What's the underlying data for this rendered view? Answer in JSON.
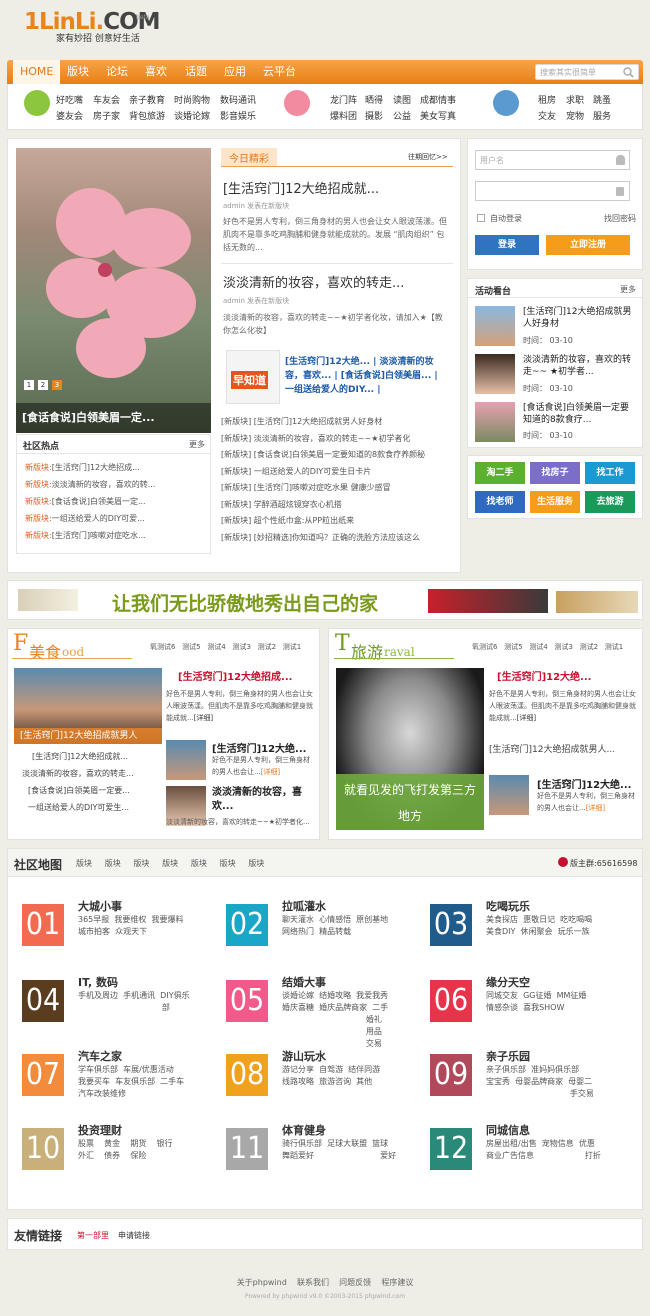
{
  "logo": {
    "text_a": "1LinLi.",
    "text_b": "COM",
    "slogan": "家有妙招 创意好生活",
    "beta": "beta"
  },
  "nav": {
    "items": [
      "HOME",
      "版块",
      "论坛",
      "喜欢",
      "话题",
      "应用",
      "云平台"
    ],
    "search_placeholder": "搜索其实很简单"
  },
  "quick": {
    "group1": [
      "好吃嘴",
      "车友会",
      "亲子教育",
      "时尚购物",
      "数码通讯",
      "婆友会",
      "房子家",
      "背包旅游",
      "谈婚论嫁",
      "影音娱乐"
    ],
    "group2": [
      "龙门阵",
      "晒得",
      "读图",
      "成都情事",
      "爆料团",
      "摄影",
      "公益",
      "美女写真"
    ],
    "group3": [
      "租房",
      "求职",
      "跳蚤",
      "交友",
      "宠物",
      "服务"
    ]
  },
  "hot": {
    "caption": "[食话食说]白领美眉一定...",
    "pages": [
      "1",
      "2",
      "3"
    ],
    "community_title": "社区热点",
    "more": "更多",
    "community": [
      {
        "tag": "新版块:",
        "text": "[生活窍门]12大绝招成..."
      },
      {
        "tag": "新版块:",
        "text": "淡淡清新的妆容，喜欢的转..."
      },
      {
        "tag": "新版块:",
        "text": "[食话食说]白领美眉一定..."
      },
      {
        "tag": "新版块:",
        "text": "一组送给爱人的DIY可爱..."
      },
      {
        "tag": "新版块:",
        "text": "[生活窍门]咳嗽对症吃水..."
      }
    ]
  },
  "today": {
    "label": "今日精彩",
    "past": "往期回忆>>",
    "a1": {
      "title": "[生活窍门]12大绝招成就...",
      "meta": "admin 发表在新版块",
      "desc": "好色不是男人专利，倒三角身材的男人也会让女人眼波荡漾。但肌肉不是靠多吃鸡胸脯和健身就能成就的。发展 “肌肉组织” 包括无数的..."
    },
    "a2": {
      "title": "淡淡清新的妆容，喜欢的转走...",
      "meta": "admin 发表在新版块",
      "desc": "淡淡清新的妆容，喜欢的转走~~★初学者化妆，请加入★【教你怎么化妆】"
    },
    "zhidao_logo": "早知道",
    "zhidao": "[生活窍门]12大绝... | 淡淡清新的妆容，喜欢... | [食话食说]白领美眉... | 一组送给爱人的DIY... |",
    "list": [
      "[新版块] [生活窍门]12大绝招成就男人好身材",
      "[新版块] 淡淡清新的妆容，喜欢的转走~~★初学者化",
      "[新版块] [食话食说]白领美眉一定要知道的8款食疗养颜秘",
      "[新版块] 一组送给爱人的DIY可爱生日卡片",
      "[新版块] [生活窍门]咳嗽对症吃水果 健康少感冒",
      "[新版块] 学醉酒超炫镜穿衣心机搭",
      "[新版块] 超个性纸巾盒:从PP粒出纸来",
      "[新版块] [妙招精选]你知道吗？正确的洗脸方法应该这么"
    ]
  },
  "login": {
    "user_placeholder": "用户名",
    "remember": "自动登录",
    "forgot": "找回密码",
    "login": "登录",
    "register": "立即注册"
  },
  "activity": {
    "title": "活动看台",
    "more": "更多",
    "items": [
      {
        "title": "[生活窍门]12大绝招成就男人好身材",
        "time": "时间： 03-10"
      },
      {
        "title": "淡淡清新的妆容，喜欢的转走~~ ★初学者...",
        "time": "时间： 03-10"
      },
      {
        "title": "[食话食说]白领美眉一定要知道的8款食疗...",
        "time": "时间： 03-10"
      }
    ]
  },
  "colorboxes": [
    "淘二手",
    "找房子",
    "找工作",
    "找老师",
    "生活服务",
    "去旅游"
  ],
  "banner": "让我们无比骄傲地秀出自己的家",
  "food": {
    "letter": "F",
    "title": "美食",
    "en": "ood",
    "tabs": [
      "氧测试6",
      "测试5",
      "测试4",
      "测试3",
      "测试2",
      "测试1"
    ],
    "img_caption": "[生活窍门]12大绝招成就男人",
    "links": [
      "[生活窍门]12大绝招成就...",
      "淡淡清新的妆容，喜欢的转走...",
      "[食话食说]白领美眉一定要...",
      "一组送给爱人的DIY可爱生..."
    ],
    "main_title": "[生活窍门]12大绝招成...",
    "main_desc": "好色不是男人专利，倒三角身材的男人也会让女人眼波荡漾。但肌肉不是靠多吃鸡胸脯和健身就能成就...",
    "detail": "[详细]",
    "s1_title": "[生活窍门]12大绝...",
    "s1_desc": "好色不是男人专利，倒三角身材的男人也会让...",
    "s2_title": "淡淡清新的妆容，喜欢...",
    "s2_desc": "淡淡清新的妆容，喜欢的转走~~★初学者化..."
  },
  "travel": {
    "letter": "T",
    "title": "旅游",
    "en": "raval",
    "tabs": [
      "氧测试6",
      "测试5",
      "测试4",
      "测试3",
      "测试2",
      "测试1"
    ],
    "img_caption": "就看见发的飞打发第三方 地方",
    "main_title": "[生活窍门]12大绝...",
    "main_desc": "好色不是男人专利，倒三角身材的男人也会让女人眼波荡漾。但肌肉不是靠多吃鸡胸脯和健身就能成就...",
    "detail": "[详细]",
    "mid_line": "[生活窍门]12大绝招成就男人...",
    "s1_title": "[生活窍门]12大绝...",
    "s1_desc": "好色不是男人专利，倒三角身材的男人也会让..."
  },
  "map": {
    "title": "社区地图",
    "tabs": [
      "版块",
      "版块",
      "版块",
      "版块",
      "版块",
      "版块",
      "版块"
    ],
    "qq": "版主群:65616598",
    "cats": [
      {
        "num": "01",
        "title": "大城小事",
        "links": "365早报  我要维权  我要爆料\n城市拍客  众观天下",
        "color": "#f26b50"
      },
      {
        "num": "02",
        "title": "拉呱灌水",
        "links": "聊天灌水  心情感悟  原创基地\n网络热门  精品转载",
        "color": "#1aa6c6"
      },
      {
        "num": "03",
        "title": "吃喝玩乐",
        "links": "美食探店  惠敬日记  吃吃喝喝\n美食DIY  休闲聚会  玩乐一族",
        "color": "#1f5c8b"
      },
      {
        "num": "04",
        "title": "IT, 数码",
        "links": "手机及周边  手机通讯  DIY俱乐\n                                 部",
        "color": "#5a3c1e"
      },
      {
        "num": "05",
        "title": "结婚大事",
        "links": "谈婚论嫁  结婚攻略  我爱我秀\n婚庆喜糖  婚庆品牌商家  二手\n                                 婚礼\n                                 用品\n                                 交易",
        "color": "#f25a8c"
      },
      {
        "num": "06",
        "title": "缘分天空",
        "links": "同城交友  GG征婚  MM征婚\n情感杂谈  喜我SHOW",
        "color": "#e8344a"
      },
      {
        "num": "07",
        "title": "汽车之家",
        "links": "学车俱乐部  车展/优惠活动\n我要买车  车友俱乐部  二手车\n汽车改装维修",
        "color": "#f28c3c"
      },
      {
        "num": "08",
        "title": "游山玩水",
        "links": "游记分享  自驾游  结伴同游\n线路攻略  旅游咨询  其他",
        "color": "#f0a21e"
      },
      {
        "num": "09",
        "title": "亲子乐园",
        "links": "亲子俱乐部  准妈妈俱乐部\n宝宝秀  母婴品牌商家  母婴二\n                                 手交易",
        "color": "#b04a5a"
      },
      {
        "num": "10",
        "title": "投资理财",
        "links": "股票    黄金    期货    银行\n外汇    债券    保险",
        "color": "#c8b078"
      },
      {
        "num": "11",
        "title": "体育健身",
        "links": "骑行俱乐部  足球大联盟  篮球\n舞蹈爱好                          爱好",
        "color": "#a8a8a8"
      },
      {
        "num": "12",
        "title": "同城信息",
        "links": "房屋出租/出售  宠物信息  优惠\n商业广告信息                    打折",
        "color": "#2a8a7a"
      }
    ]
  },
  "friends": {
    "title": "友情链接",
    "l1": "第一部里",
    "l2": "申请链接"
  },
  "footer": {
    "links": [
      "关于phpwind",
      "联系我们",
      "问题反馈",
      "程序建议"
    ],
    "powered": "Powered by phpwind v9.0 ©2003-2015 phpwind.com"
  }
}
